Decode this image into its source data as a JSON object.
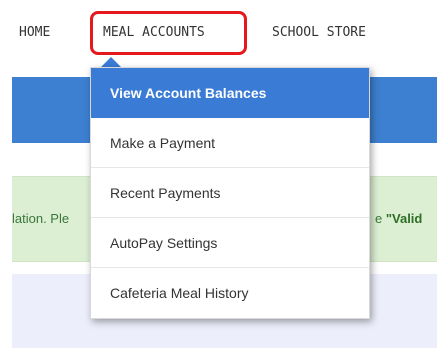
{
  "nav": {
    "home": "HOME",
    "meal_accounts": "MEAL ACCOUNTS",
    "school_store": "SCHOOL STORE"
  },
  "dropdown": {
    "items": [
      "View Account Balances",
      "Make a Payment",
      "Recent Payments",
      "AutoPay Settings",
      "Cafeteria Meal History"
    ],
    "active_index": 0
  },
  "alert": {
    "left_text": "lation. Ple",
    "right_prefix": "e ",
    "right_bold": "\"Valid"
  },
  "colors": {
    "highlight": "#e5191c",
    "primary": "#3a7bd5",
    "alert_bg": "#dcefd3",
    "panel_bg": "#eceefb"
  }
}
